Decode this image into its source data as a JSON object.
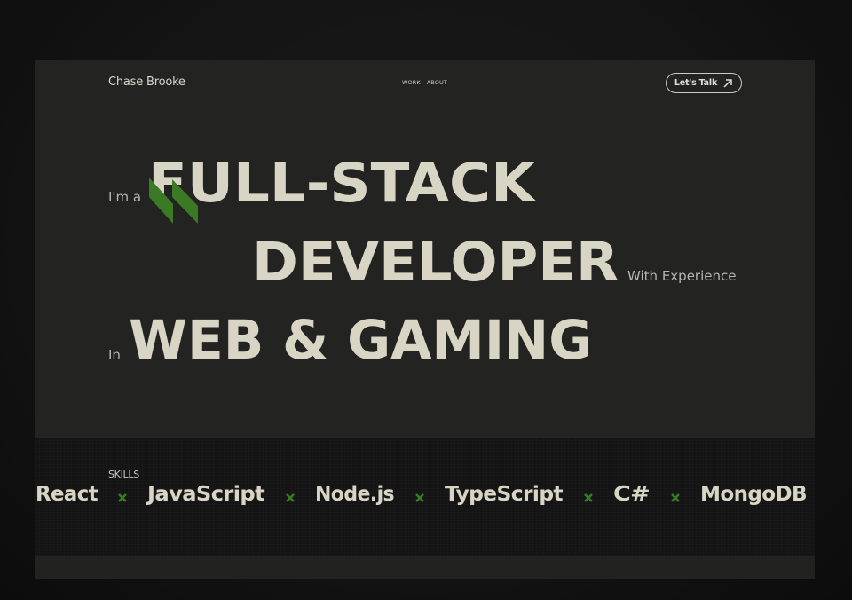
{
  "header": {
    "brand": "Chase Brooke",
    "nav": [
      "WORK",
      "ABOUT"
    ],
    "cta_label": "Let's Talk",
    "cta_icon": "arrow-up-right-icon"
  },
  "hero": {
    "line1_prefix": "I'm a",
    "line1_word": "FULL-STACK",
    "line2_word": "DEVELOPER",
    "line2_suffix": "With Experience",
    "line3_prefix": "In",
    "line3_word": "WEB & GAMING",
    "logo_icon": "double-slash-logo-icon",
    "accent_color": "#3b7a24"
  },
  "skills": {
    "label": "SKILLS",
    "items": [
      "React",
      "JavaScript",
      "Node.js",
      "TypeScript",
      "C#",
      "MongoDB"
    ],
    "separator_icon": "x-cross-icon"
  },
  "colors": {
    "background": "#121212",
    "panel": "#232322",
    "text": "#d8d5c4",
    "accent": "#3b7a24"
  }
}
